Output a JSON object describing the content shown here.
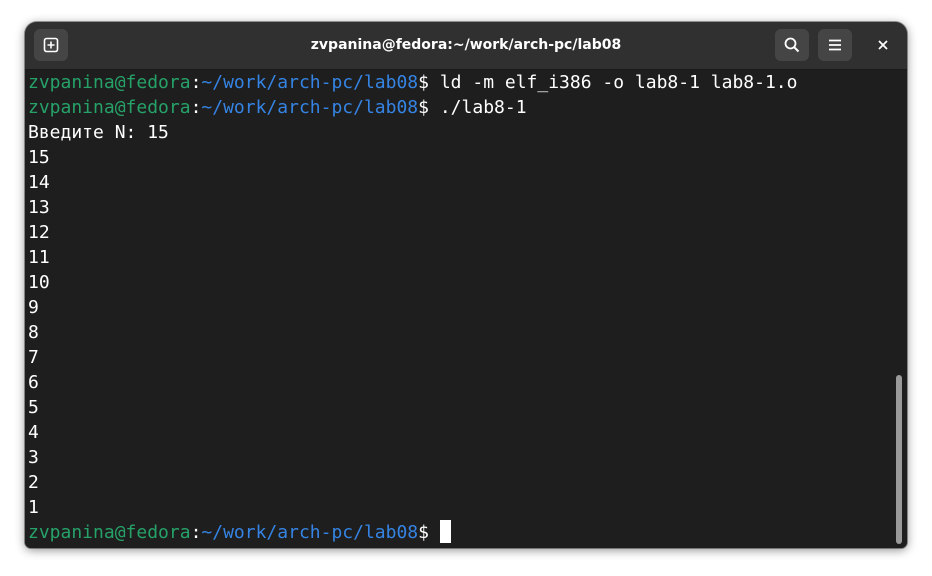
{
  "window": {
    "title": "zvpanina@fedora:~/work/arch-pc/lab08"
  },
  "header": {
    "new_tab_icon": "new-tab-icon",
    "search_icon": "search-icon",
    "menu_icon": "hamburger-menu-icon",
    "close_icon": "close-icon"
  },
  "terminal": {
    "prompt_user": "zvpanina@fedora",
    "prompt_sep": ":",
    "prompt_path": "~/work/arch-pc/lab08",
    "prompt_dollar": "$ ",
    "commands": [
      "ld -m elf_i386 -o lab8-1 lab8-1.o",
      "./lab8-1"
    ],
    "output": [
      "Введите N: 15",
      "15",
      "14",
      "13",
      "12",
      "11",
      "10",
      "9",
      "8",
      "7",
      "6",
      "5",
      "4",
      "3",
      "2",
      "1"
    ]
  },
  "scrollbar": {
    "position_fraction": 1.0,
    "visible_fraction": 0.36
  },
  "colors": {
    "prompt_user": "#26a269",
    "prompt_path": "#3584e4",
    "background": "#1e1e1e",
    "headerbar": "#303030"
  }
}
